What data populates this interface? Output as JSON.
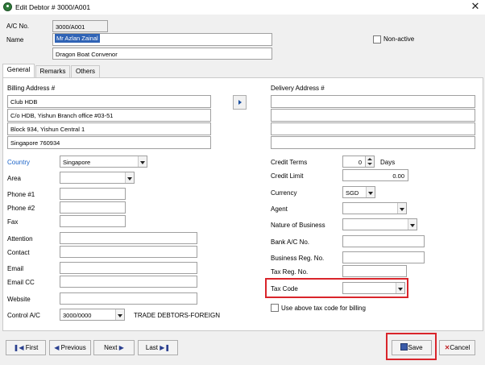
{
  "window": {
    "title": "Edit Debtor # 3000/A001",
    "close_label": "✕"
  },
  "header": {
    "ac_no_label": "A/C No.",
    "ac_no_value": "3000/A001",
    "name_label": "Name",
    "name_value": "Mr Azlan Zainal",
    "name_line2": "Dragon Boat Convenor",
    "non_active_label": "Non-active"
  },
  "tabs": [
    {
      "label": "General"
    },
    {
      "label": "Remarks"
    },
    {
      "label": "Others"
    }
  ],
  "billing": {
    "label": "Billing Address #",
    "lines": [
      "Club HDB",
      "C/o HDB, Yishun Branch office #03-51",
      "Block 934, Yishun Central 1",
      "Singapore 760934"
    ]
  },
  "delivery": {
    "label": "Delivery Address #",
    "lines": [
      "",
      "",
      "",
      ""
    ]
  },
  "left_fields": {
    "country_label": "Country",
    "country_value": "Singapore",
    "area_label": "Area",
    "area_value": "",
    "phone1_label": "Phone #1",
    "phone1_value": "",
    "phone2_label": "Phone #2",
    "phone2_value": "",
    "fax_label": "Fax",
    "fax_value": "",
    "attention_label": "Attention",
    "attention_value": "",
    "contact_label": "Contact",
    "contact_value": "",
    "email_label": "Email",
    "email_value": "",
    "emailcc_label": "Email CC",
    "emailcc_value": "",
    "website_label": "Website",
    "website_value": "",
    "control_label": "Control A/C",
    "control_value": "3000/0000",
    "control_desc": "TRADE DEBTORS-FOREIGN"
  },
  "right_fields": {
    "credit_terms_label": "Credit Terms",
    "credit_terms_value": "0",
    "days_label": "Days",
    "credit_limit_label": "Credit Limit",
    "credit_limit_value": "0.00",
    "currency_label": "Currency",
    "currency_value": "SGD",
    "agent_label": "Agent",
    "agent_value": "",
    "nature_label": "Nature of Business",
    "nature_value": "",
    "bank_label": "Bank A/C No.",
    "bank_value": "",
    "bizreg_label": "Business Reg. No.",
    "bizreg_value": "",
    "taxreg_label": "Tax Reg. No.",
    "taxreg_value": "",
    "taxcode_label": "Tax Code",
    "taxcode_value": "",
    "use_tax_label": "Use above tax code for billing"
  },
  "nav": {
    "first": "First",
    "previous": "Previous",
    "next": "Next",
    "last": "Last"
  },
  "actions": {
    "save": "Save",
    "cancel": "Cancel"
  },
  "colors": {
    "accent_label": "#1b63c8",
    "highlight": "#d9252b",
    "selection": "#2f63b5"
  },
  "icons": [
    "app-icon",
    "close-icon",
    "copy-arrow-icon",
    "first-icon",
    "previous-icon",
    "next-icon",
    "last-icon",
    "save-icon",
    "cancel-icon"
  ]
}
